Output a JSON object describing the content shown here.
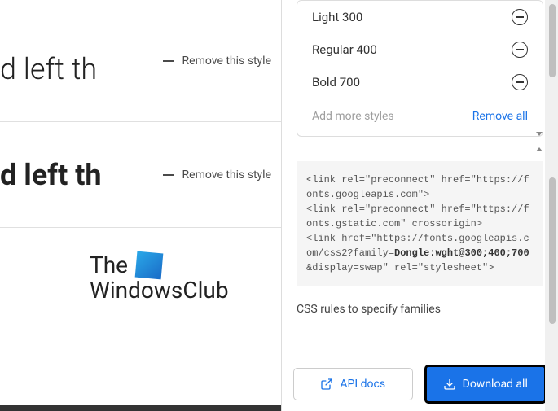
{
  "left": {
    "sample_text": "d left th",
    "remove_style": "Remove this style",
    "logo_line1": "The",
    "logo_line2": "WindowsClub"
  },
  "styles": {
    "items": [
      {
        "label": "Light 300"
      },
      {
        "label": "Regular 400"
      },
      {
        "label": "Bold 700"
      }
    ],
    "add_more": "Add more styles",
    "remove_all": "Remove all"
  },
  "code": {
    "line1": "<link rel=\"preconnect\" href=\"https://fonts.googleapis.com\">",
    "line2": "<link rel=\"preconnect\" href=\"https://fonts.gstatic.com\" crossorigin>",
    "line3_a": "<link href=\"https://fonts.googleapis.com/css2?family=",
    "line3_b": "Dongle:wght@300;400;700",
    "line3_c": "&display=swap\" rel=\"stylesheet\">"
  },
  "css_rules_label": "CSS rules to specify families",
  "buttons": {
    "api_docs": "API docs",
    "download_all": "Download all"
  }
}
